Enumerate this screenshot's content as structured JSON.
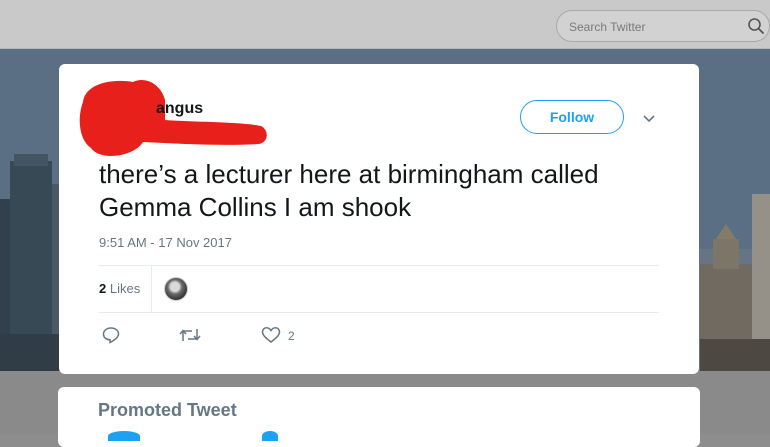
{
  "search": {
    "placeholder": "Search Twitter"
  },
  "tweet": {
    "user_name": "angus",
    "follow_label": "Follow",
    "text": "there’s a lecturer here at birmingham called Gemma Collins I am shook",
    "timestamp": "9:51 AM - 17 Nov 2017",
    "likes_count": "2",
    "likes_label": "Likes",
    "like_action_count": "2"
  },
  "promoted": {
    "title": "Promoted Tweet"
  },
  "colors": {
    "accent": "#1da1f2",
    "secondary_text": "#657786",
    "redaction": "#e8201c"
  },
  "icons": [
    "search-icon",
    "chevron-down-icon",
    "reply-icon",
    "retweet-icon",
    "heart-icon"
  ]
}
